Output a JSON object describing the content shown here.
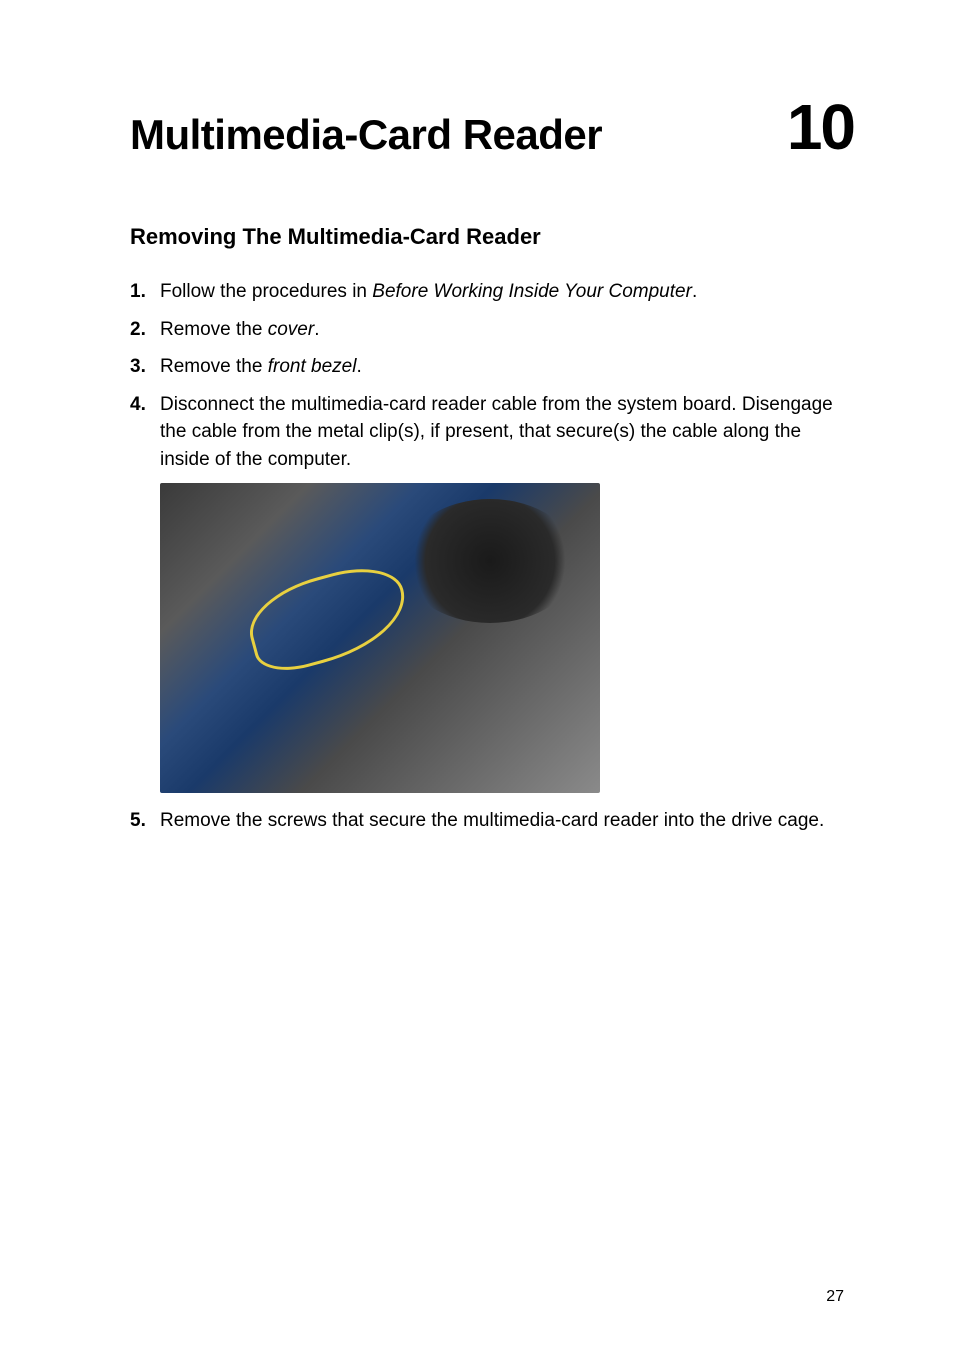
{
  "chapter": {
    "title": "Multimedia-Card Reader",
    "number": "10"
  },
  "section": {
    "title": "Removing The Multimedia-Card Reader"
  },
  "steps": [
    {
      "num": "1.",
      "prefix": "Follow the procedures in ",
      "italic": "Before Working Inside Your Computer",
      "suffix": "."
    },
    {
      "num": "2.",
      "prefix": "Remove the ",
      "italic": "cover",
      "suffix": "."
    },
    {
      "num": "3.",
      "prefix": "Remove the ",
      "italic": "front bezel",
      "suffix": "."
    },
    {
      "num": "4.",
      "text": "Disconnect the multimedia-card reader cable from the system board. Disengage the cable from the metal clip(s), if present, that secure(s) the cable along the inside of the computer."
    },
    {
      "num": "5.",
      "text": "Remove the screws that secure the multimedia-card reader into the drive cage."
    }
  ],
  "pageNumber": "27"
}
